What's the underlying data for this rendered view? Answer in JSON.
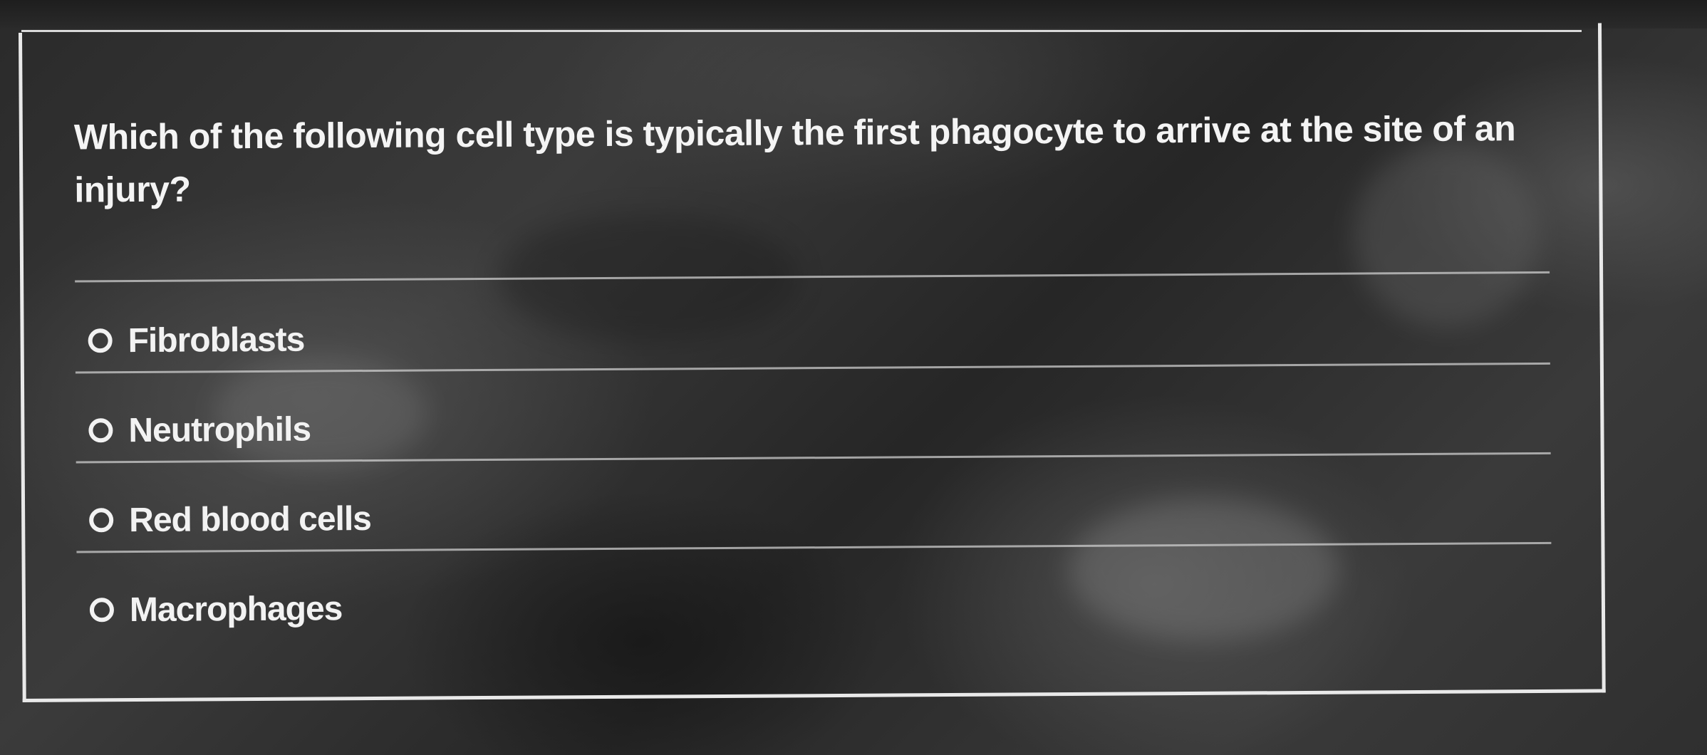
{
  "question": {
    "text": "Which of the following cell type is typically the first phagocyte to arrive at the site of an injury?"
  },
  "options": [
    {
      "label": "Fibroblasts",
      "selected": false
    },
    {
      "label": "Neutrophils",
      "selected": false
    },
    {
      "label": "Red blood cells",
      "selected": false
    },
    {
      "label": "Macrophages",
      "selected": false
    }
  ]
}
